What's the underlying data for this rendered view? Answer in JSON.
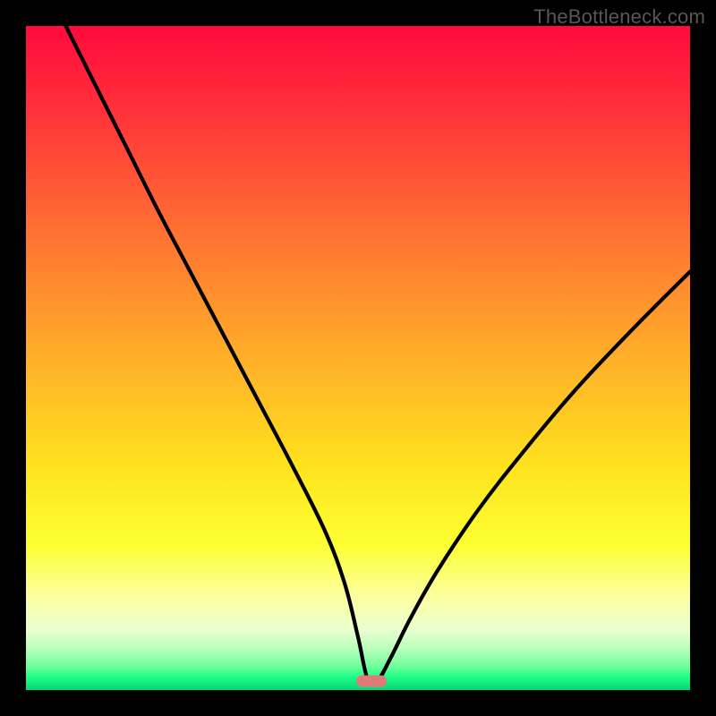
{
  "watermark": "TheBottleneck.com",
  "chart_data": {
    "type": "line",
    "title": "",
    "xlabel": "",
    "ylabel": "",
    "xlim": [
      0,
      100
    ],
    "ylim": [
      0,
      100
    ],
    "grid": false,
    "legend": false,
    "series": [
      {
        "name": "bottleneck-curve",
        "x": [
          6,
          10,
          15,
          20,
          25,
          30,
          35,
          40,
          45,
          48,
          50,
          51.5,
          53,
          55,
          58,
          62,
          68,
          75,
          83,
          92,
          100
        ],
        "y": [
          100,
          92,
          82,
          72,
          62.5,
          53,
          43.5,
          34,
          24,
          16,
          8,
          1.5,
          1.5,
          5,
          11,
          18,
          27,
          36,
          45.5,
          55,
          63
        ]
      }
    ],
    "marker": {
      "x": 52,
      "y": 1.4
    },
    "colors": {
      "gradient_top": "#ff0a3c",
      "gradient_mid": "#ffe11e",
      "gradient_bottom": "#07d574",
      "curve": "#000000",
      "marker": "#de7b79",
      "frame": "#000000"
    }
  }
}
